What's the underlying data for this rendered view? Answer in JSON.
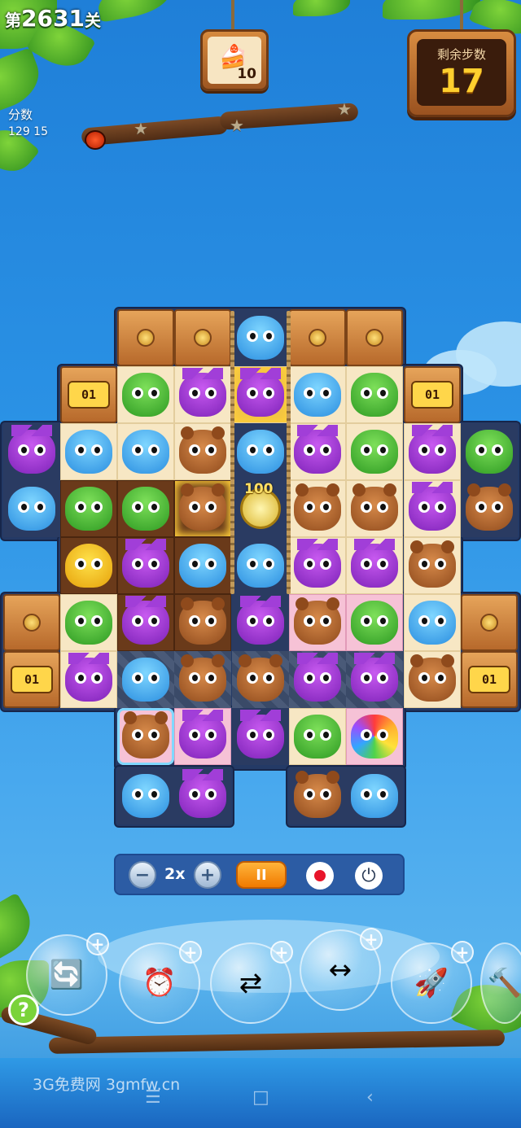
{
  "hud": {
    "level_prefix": "第",
    "level_number": "2631",
    "level_suffix": "关",
    "score_label": "分数",
    "score_value": "129 15",
    "goal_count": "10",
    "goal_icon": "cake-icon",
    "moves_label": "剩余步数",
    "moves_value": "17"
  },
  "board": {
    "lock_label": "01",
    "bonus_label": "100",
    "piece_types": [
      "owl",
      "blue",
      "frog",
      "bear",
      "chick",
      "rainbow"
    ],
    "colors": {
      "owl": "#9b3ad6",
      "blue": "#3fa7f0",
      "frog": "#3fb52c",
      "bear": "#a85a26",
      "chick": "#f2c21c"
    }
  },
  "controls": {
    "minus": "−",
    "speed": "2x",
    "plus": "+",
    "pause": "II",
    "record_icon": "record-icon",
    "power_icon": "power-icon"
  },
  "boosters": [
    {
      "icon": "shuffle-board-icon",
      "plus": "+"
    },
    {
      "icon": "clock-rewind-icon",
      "plus": "+"
    },
    {
      "icon": "swap-pieces-icon",
      "plus": "+"
    },
    {
      "icon": "horizontal-rocket-icon",
      "plus": "+"
    },
    {
      "icon": "vertical-rocket-icon",
      "plus": "+"
    },
    {
      "icon": "hammer-icon",
      "plus": "+"
    }
  ],
  "help_label": "?",
  "watermark": "3G免费网 3gmfw.cn",
  "system_nav": {
    "menu": "☰",
    "home": "□",
    "back": "‹"
  }
}
